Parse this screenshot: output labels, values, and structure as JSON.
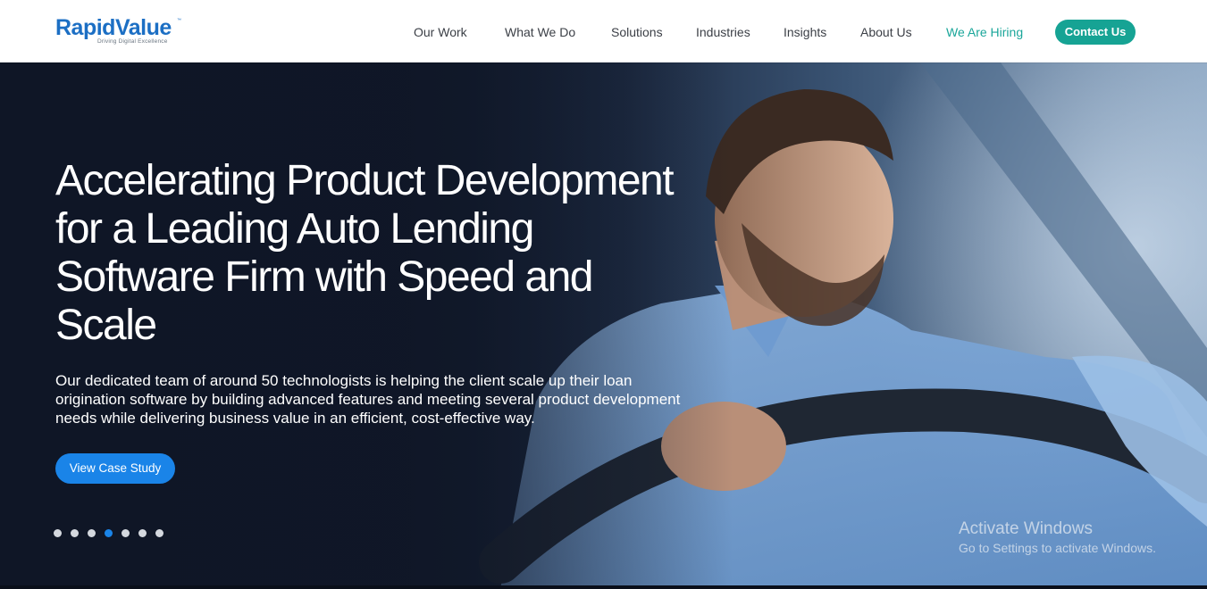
{
  "brand": {
    "name": "RapidValue",
    "trademark": "™",
    "tagline": "Driving Digital Excellence",
    "primary_color": "#1c6fc4"
  },
  "nav": {
    "items": [
      {
        "label": "Our Work"
      },
      {
        "label": "What We Do"
      },
      {
        "label": "Solutions"
      },
      {
        "label": "Industries"
      },
      {
        "label": "Insights"
      },
      {
        "label": "About Us"
      },
      {
        "label": "We Are Hiring",
        "color": "#1aa69a"
      }
    ],
    "contact_label": "Contact Us",
    "contact_color": "#16a394"
  },
  "hero": {
    "headline": "Accelerating Product Development for a Leading Auto Lending Software Firm with Speed and Scale",
    "subtext": "Our dedicated team of around 50 technologists is helping the client scale up their loan origination software by building advanced features and meeting several product development needs while delivering business value in an efficient, cost-effective way.",
    "cta_label": "View Case Study",
    "cta_color": "#1a84e8",
    "carousel": {
      "total_slides": 7,
      "active_index": 3
    }
  },
  "watermark": {
    "title": "Activate Windows",
    "subtitle": "Go to Settings to activate Windows."
  }
}
